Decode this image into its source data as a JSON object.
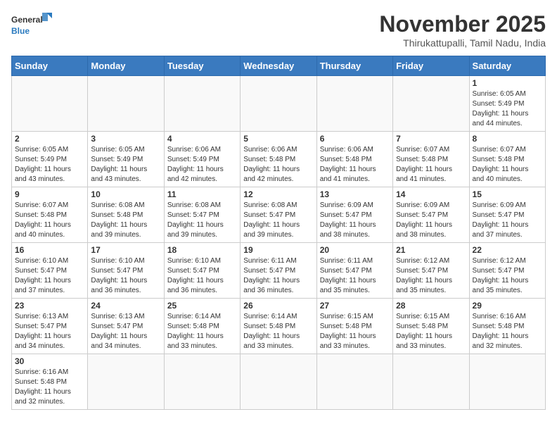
{
  "header": {
    "logo_general": "General",
    "logo_blue": "Blue",
    "month_title": "November 2025",
    "location": "Thirukattupalli, Tamil Nadu, India"
  },
  "days_of_week": [
    "Sunday",
    "Monday",
    "Tuesday",
    "Wednesday",
    "Thursday",
    "Friday",
    "Saturday"
  ],
  "weeks": [
    [
      {
        "day": "",
        "info": ""
      },
      {
        "day": "",
        "info": ""
      },
      {
        "day": "",
        "info": ""
      },
      {
        "day": "",
        "info": ""
      },
      {
        "day": "",
        "info": ""
      },
      {
        "day": "",
        "info": ""
      },
      {
        "day": "1",
        "info": "Sunrise: 6:05 AM\nSunset: 5:49 PM\nDaylight: 11 hours\nand 44 minutes."
      }
    ],
    [
      {
        "day": "2",
        "info": "Sunrise: 6:05 AM\nSunset: 5:49 PM\nDaylight: 11 hours\nand 43 minutes."
      },
      {
        "day": "3",
        "info": "Sunrise: 6:05 AM\nSunset: 5:49 PM\nDaylight: 11 hours\nand 43 minutes."
      },
      {
        "day": "4",
        "info": "Sunrise: 6:06 AM\nSunset: 5:49 PM\nDaylight: 11 hours\nand 42 minutes."
      },
      {
        "day": "5",
        "info": "Sunrise: 6:06 AM\nSunset: 5:48 PM\nDaylight: 11 hours\nand 42 minutes."
      },
      {
        "day": "6",
        "info": "Sunrise: 6:06 AM\nSunset: 5:48 PM\nDaylight: 11 hours\nand 41 minutes."
      },
      {
        "day": "7",
        "info": "Sunrise: 6:07 AM\nSunset: 5:48 PM\nDaylight: 11 hours\nand 41 minutes."
      },
      {
        "day": "8",
        "info": "Sunrise: 6:07 AM\nSunset: 5:48 PM\nDaylight: 11 hours\nand 40 minutes."
      }
    ],
    [
      {
        "day": "9",
        "info": "Sunrise: 6:07 AM\nSunset: 5:48 PM\nDaylight: 11 hours\nand 40 minutes."
      },
      {
        "day": "10",
        "info": "Sunrise: 6:08 AM\nSunset: 5:48 PM\nDaylight: 11 hours\nand 39 minutes."
      },
      {
        "day": "11",
        "info": "Sunrise: 6:08 AM\nSunset: 5:47 PM\nDaylight: 11 hours\nand 39 minutes."
      },
      {
        "day": "12",
        "info": "Sunrise: 6:08 AM\nSunset: 5:47 PM\nDaylight: 11 hours\nand 39 minutes."
      },
      {
        "day": "13",
        "info": "Sunrise: 6:09 AM\nSunset: 5:47 PM\nDaylight: 11 hours\nand 38 minutes."
      },
      {
        "day": "14",
        "info": "Sunrise: 6:09 AM\nSunset: 5:47 PM\nDaylight: 11 hours\nand 38 minutes."
      },
      {
        "day": "15",
        "info": "Sunrise: 6:09 AM\nSunset: 5:47 PM\nDaylight: 11 hours\nand 37 minutes."
      }
    ],
    [
      {
        "day": "16",
        "info": "Sunrise: 6:10 AM\nSunset: 5:47 PM\nDaylight: 11 hours\nand 37 minutes."
      },
      {
        "day": "17",
        "info": "Sunrise: 6:10 AM\nSunset: 5:47 PM\nDaylight: 11 hours\nand 36 minutes."
      },
      {
        "day": "18",
        "info": "Sunrise: 6:10 AM\nSunset: 5:47 PM\nDaylight: 11 hours\nand 36 minutes."
      },
      {
        "day": "19",
        "info": "Sunrise: 6:11 AM\nSunset: 5:47 PM\nDaylight: 11 hours\nand 36 minutes."
      },
      {
        "day": "20",
        "info": "Sunrise: 6:11 AM\nSunset: 5:47 PM\nDaylight: 11 hours\nand 35 minutes."
      },
      {
        "day": "21",
        "info": "Sunrise: 6:12 AM\nSunset: 5:47 PM\nDaylight: 11 hours\nand 35 minutes."
      },
      {
        "day": "22",
        "info": "Sunrise: 6:12 AM\nSunset: 5:47 PM\nDaylight: 11 hours\nand 35 minutes."
      }
    ],
    [
      {
        "day": "23",
        "info": "Sunrise: 6:13 AM\nSunset: 5:47 PM\nDaylight: 11 hours\nand 34 minutes."
      },
      {
        "day": "24",
        "info": "Sunrise: 6:13 AM\nSunset: 5:47 PM\nDaylight: 11 hours\nand 34 minutes."
      },
      {
        "day": "25",
        "info": "Sunrise: 6:14 AM\nSunset: 5:48 PM\nDaylight: 11 hours\nand 33 minutes."
      },
      {
        "day": "26",
        "info": "Sunrise: 6:14 AM\nSunset: 5:48 PM\nDaylight: 11 hours\nand 33 minutes."
      },
      {
        "day": "27",
        "info": "Sunrise: 6:15 AM\nSunset: 5:48 PM\nDaylight: 11 hours\nand 33 minutes."
      },
      {
        "day": "28",
        "info": "Sunrise: 6:15 AM\nSunset: 5:48 PM\nDaylight: 11 hours\nand 33 minutes."
      },
      {
        "day": "29",
        "info": "Sunrise: 6:16 AM\nSunset: 5:48 PM\nDaylight: 11 hours\nand 32 minutes."
      }
    ],
    [
      {
        "day": "30",
        "info": "Sunrise: 6:16 AM\nSunset: 5:48 PM\nDaylight: 11 hours\nand 32 minutes."
      },
      {
        "day": "",
        "info": ""
      },
      {
        "day": "",
        "info": ""
      },
      {
        "day": "",
        "info": ""
      },
      {
        "day": "",
        "info": ""
      },
      {
        "day": "",
        "info": ""
      },
      {
        "day": "",
        "info": ""
      }
    ]
  ]
}
